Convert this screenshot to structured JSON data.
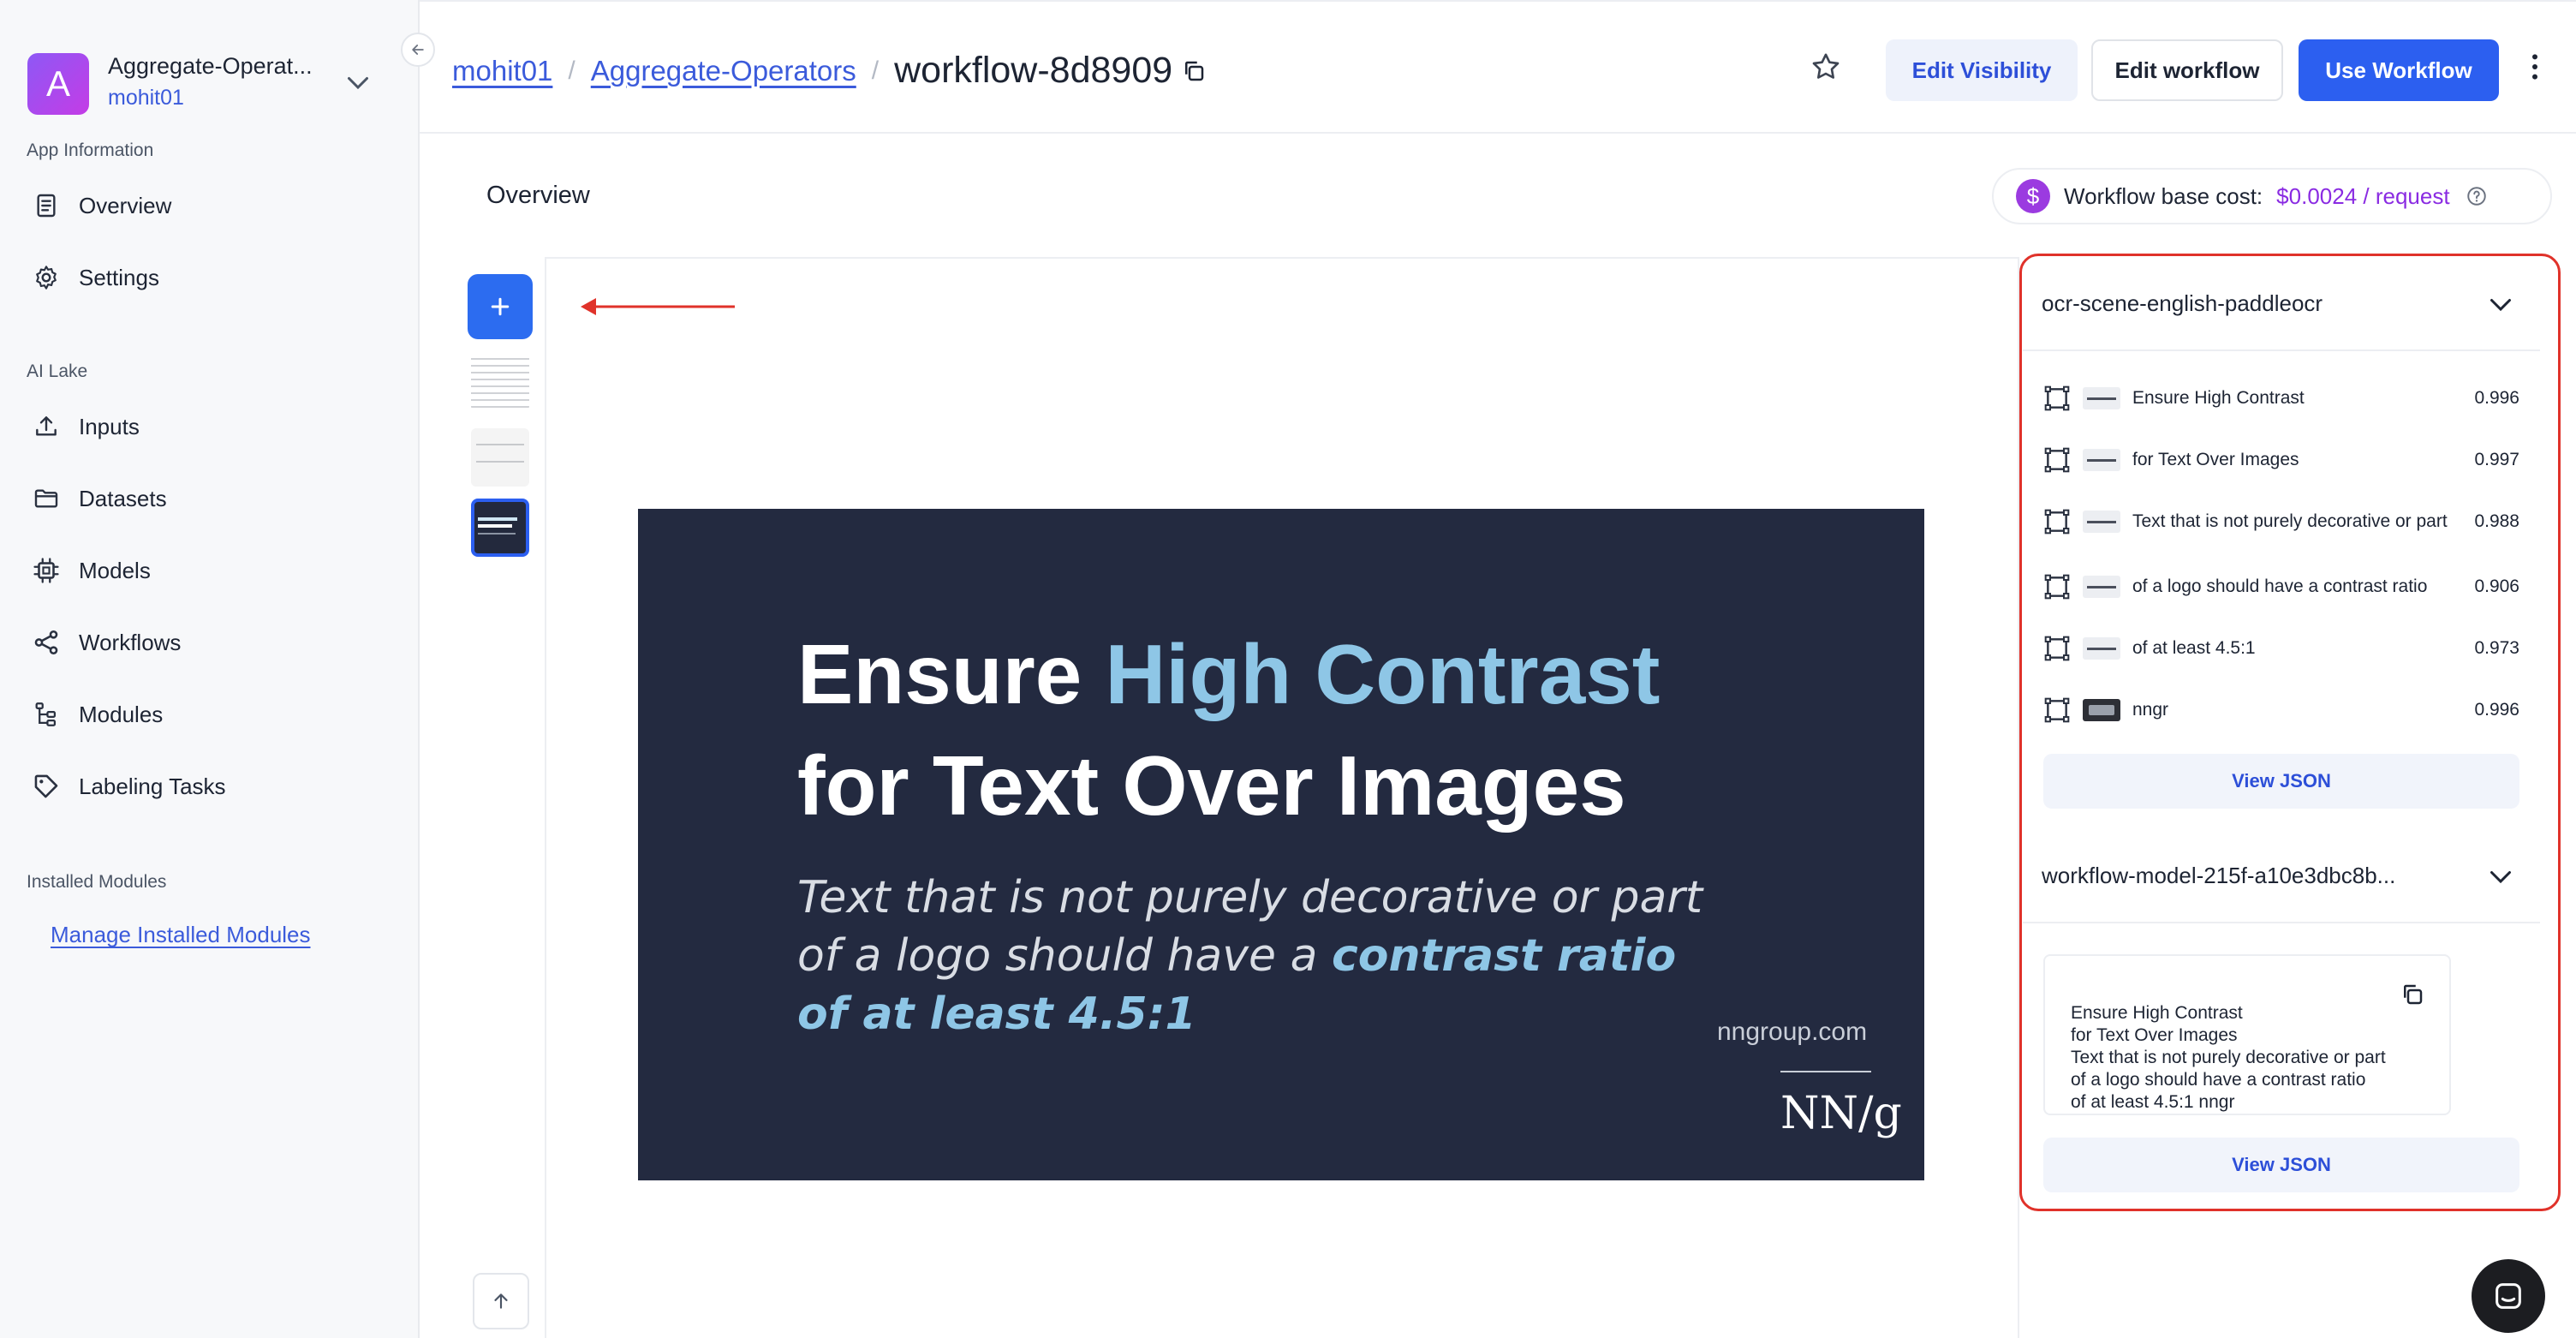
{
  "sidebar": {
    "app": {
      "avatar_letter": "A",
      "name": "Aggregate-Operat...",
      "owner": "mohit01"
    },
    "section_app_info": "App Information",
    "app_info_items": [
      {
        "label": "Overview",
        "icon": "document-icon"
      },
      {
        "label": "Settings",
        "icon": "gear-icon"
      }
    ],
    "section_ai_lake": "AI Lake",
    "ai_lake_items": [
      {
        "label": "Inputs",
        "icon": "upload-icon"
      },
      {
        "label": "Datasets",
        "icon": "folder-icon"
      },
      {
        "label": "Models",
        "icon": "chip-icon"
      },
      {
        "label": "Workflows",
        "icon": "share-icon"
      },
      {
        "label": "Modules",
        "icon": "modules-icon"
      },
      {
        "label": "Labeling Tasks",
        "icon": "tag-icon"
      }
    ],
    "section_installed": "Installed Modules",
    "manage_link": "Manage Installed Modules"
  },
  "header": {
    "breadcrumb": [
      "mohit01",
      "Aggregate-Operators"
    ],
    "separator": "/",
    "current": "workflow-8d8909",
    "edit_visibility": "Edit Visibility",
    "edit_workflow": "Edit workflow",
    "use_workflow": "Use Workflow"
  },
  "overview": {
    "title": "Overview",
    "cost_symbol": "$",
    "cost_label": "Workflow base cost:",
    "cost_value": "$0.0024 / request"
  },
  "image": {
    "title_line1_a": "Ensure ",
    "title_line1_b": "High Contrast",
    "title_line2": "for Text Over Images",
    "body_line1": "Text that is not purely decorative or part",
    "body_line2_a": "of a logo should have a ",
    "body_line2_b": "contrast ratio",
    "body_line3": "of at least 4.5:1",
    "domain": "nngroup.com",
    "logo": "NN/g"
  },
  "results": {
    "ocr_model": "ocr-scene-english-paddleocr",
    "ocr_rows": [
      {
        "text": "Ensure High Contrast",
        "score": "0.996"
      },
      {
        "text": "for Text Over Images",
        "score": "0.997"
      },
      {
        "text": "Text that is not purely decorative or part",
        "score": "0.988"
      },
      {
        "text": "of a logo should have a contrast ratio",
        "score": "0.906"
      },
      {
        "text": "of at least 4.5:1",
        "score": "0.973"
      },
      {
        "text": "nngr",
        "score": "0.996"
      }
    ],
    "view_json": "View JSON",
    "text_model": "workflow-model-215f-a10e3dbc8b...",
    "text_output": "Ensure High Contrast\nfor Text Over Images\nText that is not purely decorative or part\nof a logo should have a contrast ratio\nof at least 4.5:1 nngr",
    "view_json_2": "View JSON"
  },
  "colors": {
    "primary": "#2c5ff0",
    "link": "#3b5bdb",
    "cost": "#8a2be2",
    "highlight": "#e0322a",
    "image_bg": "#232a40",
    "image_accent": "#8ec6e6"
  }
}
